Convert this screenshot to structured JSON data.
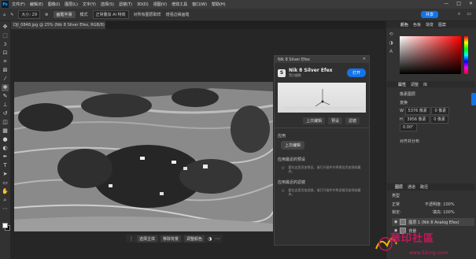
{
  "menu": {
    "logo": "Ps",
    "items": [
      "文件(F)",
      "编辑(E)",
      "图像(I)",
      "图层(L)",
      "文字(Y)",
      "选择(S)",
      "滤镜(T)",
      "3D(D)",
      "视图(V)",
      "增效工具",
      "窗口(W)",
      "帮助(H)"
    ]
  },
  "window_controls": [
    "—",
    "□",
    "✕"
  ],
  "options": {
    "size_value": "大小: 29",
    "mode_label": "画笔平滑",
    "mode_select": "模式",
    "mode_value": "正常叠加 AI 特效",
    "checkbox1": "对所有图层取样",
    "checkbox2": "增强边缘画笔",
    "share": "共享"
  },
  "document_tab": "DJI_0848.jpg @ 25% (Nik 8 Silver Efex, RGB/8) *",
  "nik_panel": {
    "header": "Nik 8 Silver Efex",
    "name": "Nik 8 Silver Efex",
    "subtitle": "黑白摄影",
    "open_button": "打开",
    "tabs": [
      "上次编辑",
      "预设",
      "滤镜"
    ],
    "apply_label": "应用",
    "last_edit_pill": "上次编辑",
    "recent_presets_label": "应用最近的预设",
    "recent_presets_text": "要在这里添加预设，请打开插件并将预设添加到收藏夹。",
    "recent_filters_label": "应用最近的滤镜",
    "recent_filters_text": "要在这里添加滤镜，请打开插件并将滤镜添加到收藏夹。"
  },
  "floatbar": {
    "select_subject": "选择主体",
    "remove_bg": "移除背景",
    "adjust_color": "调整颜色"
  },
  "right_panel": {
    "color_tabs": [
      "颜色",
      "色板",
      "渐变",
      "图案"
    ],
    "props_tabs": [
      "属性",
      "调整",
      "库"
    ],
    "pixel_layer": "像素图层",
    "transform": "变换",
    "w_label": "W",
    "w_value": "5376 像素",
    "h_label": "H",
    "h_value": "3956 像素",
    "x_value": "0 像素",
    "y_value": "0 像素",
    "angle": "0.00°",
    "align_label": "对齐并分布",
    "layers_tabs": [
      "图层",
      "通道",
      "路径"
    ],
    "kind_label": "类型",
    "blend_mode": "正常",
    "opacity": "不透明度: 100%",
    "lock": "锁定:",
    "fill": "填充: 100%",
    "layer1": "图层 1 (Nik 8 Analog Efex)",
    "layer2": "背景"
  },
  "watermark": {
    "text": "華印社區",
    "url": "www.52cnp.com"
  }
}
